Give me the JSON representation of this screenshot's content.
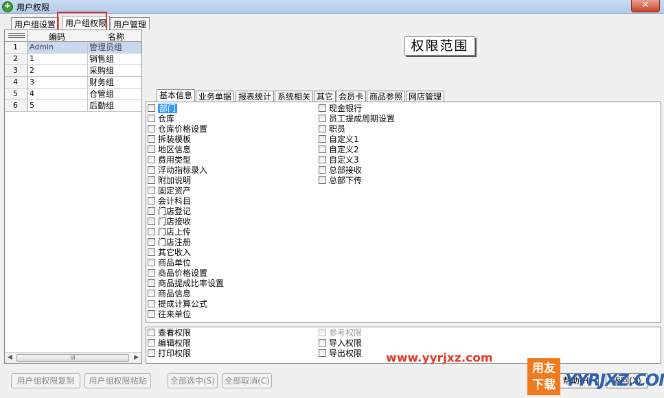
{
  "window": {
    "title": "用户权限",
    "close_glyph": "✕",
    "app_icon_glyph": "✚"
  },
  "top_tabs": [
    {
      "label": "用户组设置"
    },
    {
      "label": "用户组权限"
    },
    {
      "label": "用户管理"
    }
  ],
  "group_grid": {
    "columns": {
      "code": "编码",
      "name": "名称"
    },
    "rows": [
      {
        "idx": "1",
        "code": "Admin",
        "name": "管理员组"
      },
      {
        "idx": "2",
        "code": "1",
        "name": "销售组"
      },
      {
        "idx": "3",
        "code": "2",
        "name": "采购组"
      },
      {
        "idx": "4",
        "code": "3",
        "name": "财务组"
      },
      {
        "idx": "5",
        "code": "4",
        "name": "仓管组"
      },
      {
        "idx": "6",
        "code": "5",
        "name": "后勤组"
      }
    ],
    "scroll_left": "◀",
    "scroll_right": "▶",
    "scroll_grip": "III"
  },
  "scope_button": "权限范围",
  "perm_tabs": [
    {
      "label": "基本信息"
    },
    {
      "label": "业务单据"
    },
    {
      "label": "报表统计"
    },
    {
      "label": "系统相关"
    },
    {
      "label": "其它"
    },
    {
      "label": "会员卡"
    },
    {
      "label": "商品参照"
    },
    {
      "label": "网店管理"
    }
  ],
  "perm_items_col1": [
    "部门",
    "仓库",
    "仓库价格设置",
    "拆装模板",
    "地区信息",
    "费用类型",
    "浮动指标录入",
    "附加说明",
    "固定资产",
    "会计科目",
    "门店登记",
    "门店接收",
    "门店上传",
    "门店注册",
    "其它收入",
    "商品单位",
    "商品价格设置",
    "商品提成比率设置",
    "商品信息",
    "提成计算公式",
    "往来单位"
  ],
  "perm_items_col2": [
    "现金银行",
    "员工提成周期设置",
    "职员",
    "自定义1",
    "自定义2",
    "自定义3",
    "总部接收",
    "总部下传"
  ],
  "rights": {
    "view": "查看权限",
    "edit": "编辑权限",
    "print": "打印权限",
    "reference": "参考权限",
    "import": "导入权限",
    "export": "导出权限"
  },
  "buttons": {
    "copy": "用户组权限复制",
    "paste": "用户组权限粘贴",
    "select_all": "全部选中(S)",
    "deselect_all": "全部取消(C)",
    "help": "帮助(H)",
    "back": "返回(X)"
  },
  "watermark": {
    "url": "www.yyrjxz.com",
    "logo": "用友下载",
    "site": "YYRJXZ.COM"
  }
}
